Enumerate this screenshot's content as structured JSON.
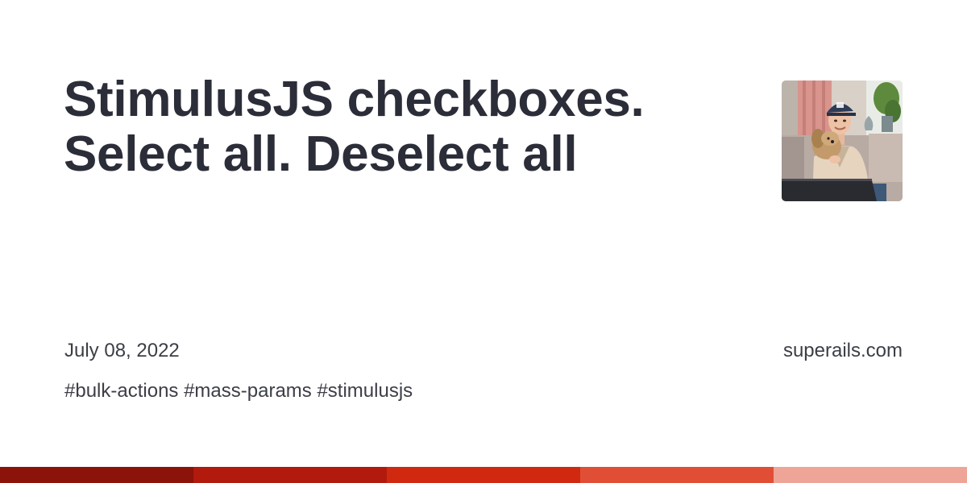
{
  "title": {
    "line1": "StimulusJS checkboxes.",
    "line2": "Select all. Deselect all"
  },
  "meta": {
    "date": "July 08, 2022",
    "site": "superails.com"
  },
  "tags": "#bulk-actions #mass-params #stimulusjs",
  "avatar": {
    "icon": "author-photo"
  },
  "stripe": {
    "colors": [
      "#8b1309",
      "#b11a0c",
      "#d0290f",
      "#e04e35",
      "#eea597"
    ]
  }
}
